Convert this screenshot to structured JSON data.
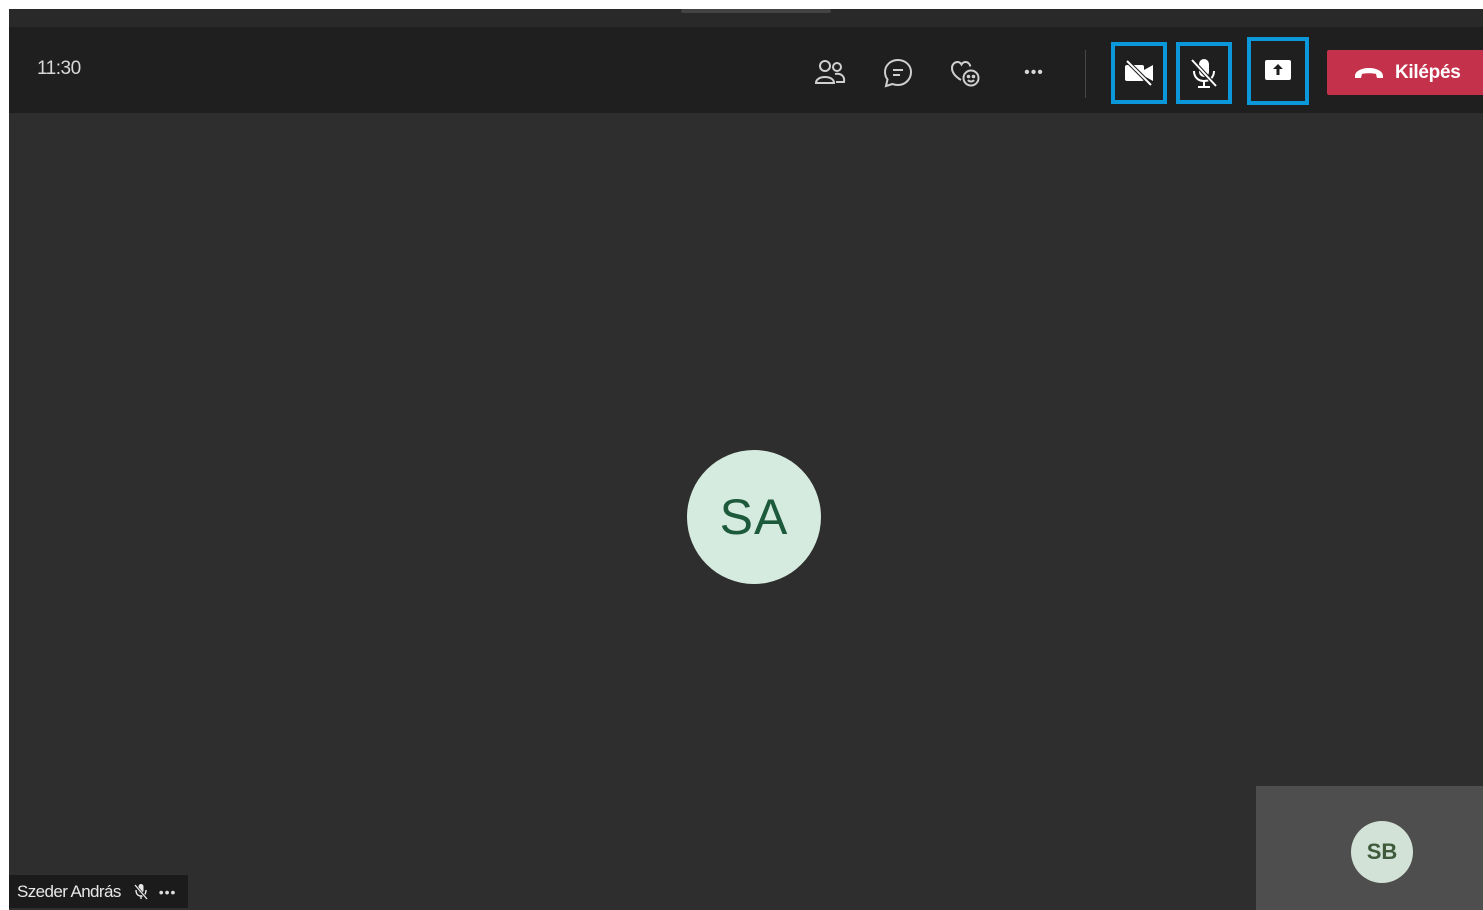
{
  "toolbar": {
    "time": "11:30",
    "buttons": [
      {
        "name": "participants",
        "icon": "participants-icon"
      },
      {
        "name": "chat",
        "icon": "chat-icon"
      },
      {
        "name": "reactions",
        "icon": "reactions-icon"
      },
      {
        "name": "more",
        "icon": "more-icon"
      },
      {
        "name": "camera",
        "icon": "camera-off-icon",
        "state": "off",
        "highlighted": true
      },
      {
        "name": "mic",
        "icon": "mic-off-icon",
        "state": "muted",
        "highlighted": true
      },
      {
        "name": "share",
        "icon": "share-screen-icon",
        "highlighted": true
      }
    ],
    "leave_label": "Kilépés",
    "more_label": "•••"
  },
  "stage": {
    "main_avatar_initials": "SA",
    "participant_name": "Szeder András",
    "participant_more": "•••",
    "self_avatar_initials": "SB"
  },
  "colors": {
    "background": "#2e2e2e",
    "toolbar": "#1f1f1f",
    "highlight": "#0a98db",
    "leave": "#c4314b",
    "avatar_main": "#d6ebdf",
    "avatar_text": "#1d5a3c"
  }
}
